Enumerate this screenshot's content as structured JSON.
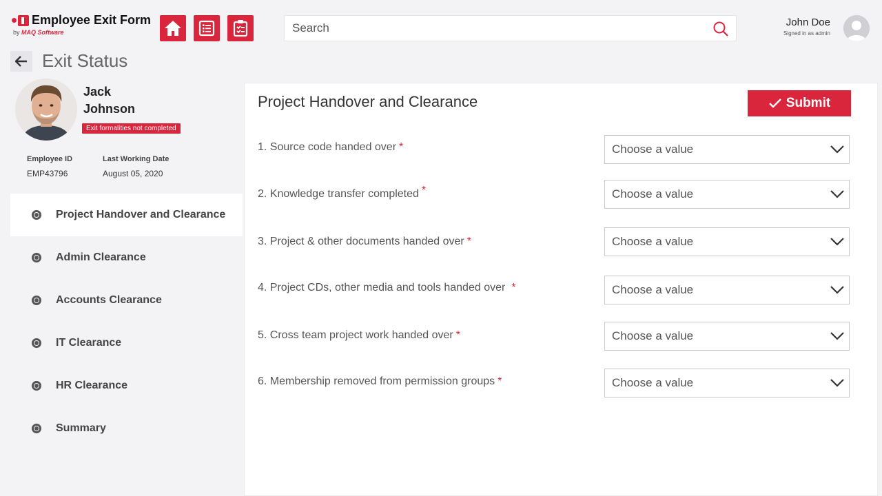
{
  "app": {
    "title": "Employee Exit Form",
    "by": "by",
    "vendor": "MAQ Software"
  },
  "nav": [
    {
      "name": "home-icon"
    },
    {
      "name": "list-icon"
    },
    {
      "name": "clipboard-icon"
    }
  ],
  "search": {
    "placeholder": "Search",
    "value": ""
  },
  "user": {
    "name": "John Doe",
    "role": "Signed in as admin"
  },
  "page": {
    "title": "Exit Status"
  },
  "employee": {
    "first_name": "Jack",
    "last_name": "Johnson",
    "status_badge": "Exit formalities not completed",
    "id_label": "Employee ID",
    "id_value": "EMP43796",
    "date_label": "Last Working Date",
    "date_value": "August 05, 2020"
  },
  "sidebar": {
    "items": [
      {
        "label": "Project Handover and Clearance",
        "active": true
      },
      {
        "label": "Admin Clearance",
        "active": false
      },
      {
        "label": "Accounts Clearance",
        "active": false
      },
      {
        "label": "IT Clearance",
        "active": false
      },
      {
        "label": "HR Clearance",
        "active": false
      },
      {
        "label": "Summary",
        "active": false
      }
    ]
  },
  "main": {
    "title": "Project Handover and Clearance",
    "submit_label": "Submit",
    "required_mark": "*",
    "questions": [
      {
        "label": "1. Source code handed over",
        "value": "Choose a value"
      },
      {
        "label": "2. Knowledge transfer completed",
        "value": "Choose a value"
      },
      {
        "label": "3. Project & other documents handed over",
        "value": "Choose a value"
      },
      {
        "label": "4. Project CDs, other media and tools handed over",
        "value": "Choose a value"
      },
      {
        "label": "5. Cross team project work handed over",
        "value": "Choose a value"
      },
      {
        "label": "6. Membership removed from permission groups",
        "value": "Choose a value"
      }
    ]
  },
  "colors": {
    "accent": "#d9263c",
    "background": "#f3f3f5",
    "panel": "#ffffff"
  }
}
